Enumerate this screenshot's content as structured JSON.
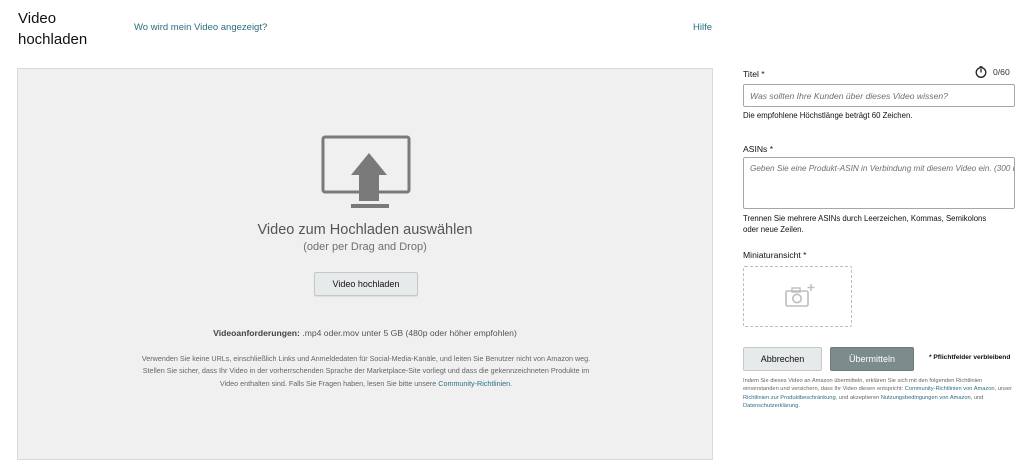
{
  "header": {
    "title": "Video hochladen",
    "where_link": "Wo wird mein Video angezeigt?",
    "help_link": "Hilfe"
  },
  "dropzone": {
    "icon": "monitor-upload-icon",
    "title": "Video zum Hochladen auswählen",
    "subtitle": "(oder per Drag and Drop)",
    "button_label": "Video hochladen",
    "requirements_label": "Videoanforderungen:",
    "requirements_text": ".mp4 oder.mov unter 5 GB (480p oder höher empfohlen)",
    "policy_line1": "Verwenden Sie keine URLs, einschließlich Links und Anmeldedaten für Social-Media-Kanäle, und leiten Sie Benutzer nicht von Amazon weg.",
    "policy_line2": "Stellen Sie sicher, dass Ihr Video in der vorherrschenden Sprache der Marketplace-Site vorliegt und dass die gekennzeichneten Produkte im",
    "policy_line3": "Video enthalten sind. Falls Sie Fragen haben, lesen Sie bitte unsere",
    "policy_link": "Community-Richtlinien",
    "policy_end": "."
  },
  "form": {
    "title_label": "Titel *",
    "title_counter": "0/60",
    "title_counter_icon": "timer-icon",
    "title_value": "",
    "title_placeholder": "Was sollten Ihre Kunden über dieses Video wissen?",
    "title_hint": "Die empfohlene Höchstlänge beträgt 60 Zeichen.",
    "asins_label": "ASINs *",
    "asins_value": "",
    "asins_placeholder": "Geben Sie eine Produkt-ASIN in Verbindung mit diesem Video ein. (300 m",
    "asins_hint_line1": "Trennen Sie mehrere ASINs durch Leerzeichen, Kommas, Semikolons",
    "asins_hint_line2": "oder neue Zeilen.",
    "thumbnail_label": "Miniaturansicht *",
    "thumbnail_icon": "camera-add-icon"
  },
  "actions": {
    "cancel_label": "Abbrechen",
    "submit_label": "Übermitteln",
    "required_note": "* Pflichtfelder verbleibend"
  },
  "legal": {
    "t1": "Indem Sie dieses Video an Amazon übermitteln, erklären Sie sich mit den folgenden Richtlinien einverstanden und versichern, dass Ihr Video diesen entspricht:",
    "l1": "Community-Richtlinien von Amazon",
    "t2": ", unser",
    "l2": "Richtlinien zur Produktbeschränkung",
    "t3": ", und akzeptieren",
    "l3": "Nutzungsbedingungen von Amazon",
    "t4": ", und",
    "l4": "Datenschutzerklärung",
    "t5": "."
  },
  "colors": {
    "link": "#2a6f85",
    "submit_bg": "#7c8b8b",
    "dropzone_bg": "#f0f0f0"
  }
}
